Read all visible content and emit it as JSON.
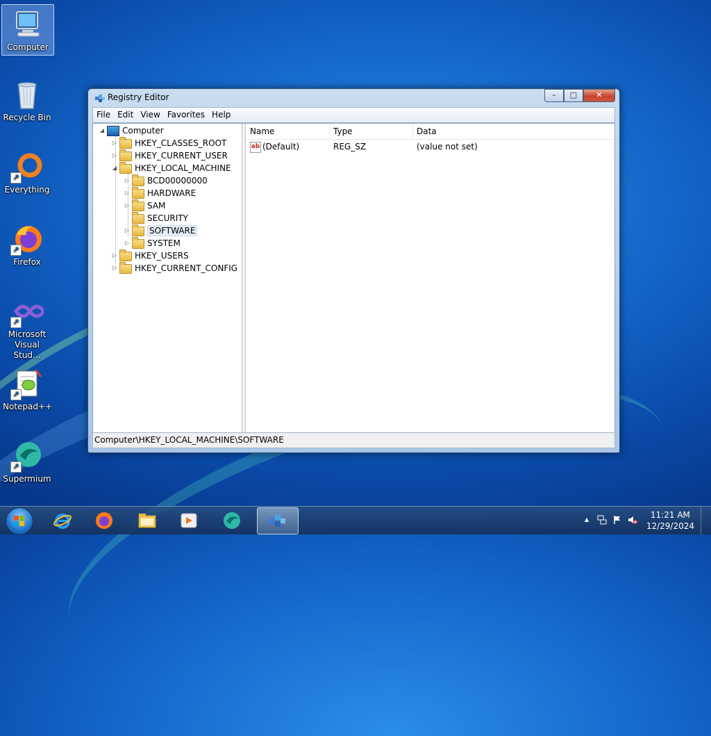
{
  "desktop": {
    "icons": [
      {
        "label": "Computer"
      },
      {
        "label": "Recycle Bin"
      },
      {
        "label": "Everything"
      },
      {
        "label": "Firefox"
      },
      {
        "label": "Microsoft Visual Stud..."
      },
      {
        "label": "Notepad++"
      },
      {
        "label": "Supermium"
      }
    ]
  },
  "window": {
    "title": "Registry Editor",
    "buttons": {
      "minimize": "–",
      "maximize": "□",
      "close": "✕"
    },
    "menu": [
      "File",
      "Edit",
      "View",
      "Favorites",
      "Help"
    ],
    "tree": {
      "root": "Computer",
      "hives": [
        "HKEY_CLASSES_ROOT",
        "HKEY_CURRENT_USER",
        "HKEY_LOCAL_MACHINE",
        "HKEY_USERS",
        "HKEY_CURRENT_CONFIG"
      ],
      "hklm_children": [
        "BCD00000000",
        "HARDWARE",
        "SAM",
        "SECURITY",
        "SOFTWARE",
        "SYSTEM"
      ],
      "selected": "SOFTWARE"
    },
    "list": {
      "columns": [
        "Name",
        "Type",
        "Data"
      ],
      "rows": [
        {
          "name": "(Default)",
          "type": "REG_SZ",
          "data": "(value not set)"
        }
      ]
    },
    "status": "Computer\\HKEY_LOCAL_MACHINE\\SOFTWARE"
  },
  "taskbar": {
    "clock_time": "11:21 AM",
    "clock_date": "12/29/2024",
    "tray_arrow": "▲"
  },
  "colors": {
    "desktop": "#1466c8",
    "close_button": "#c7452d",
    "folder": "#e8b83e"
  }
}
